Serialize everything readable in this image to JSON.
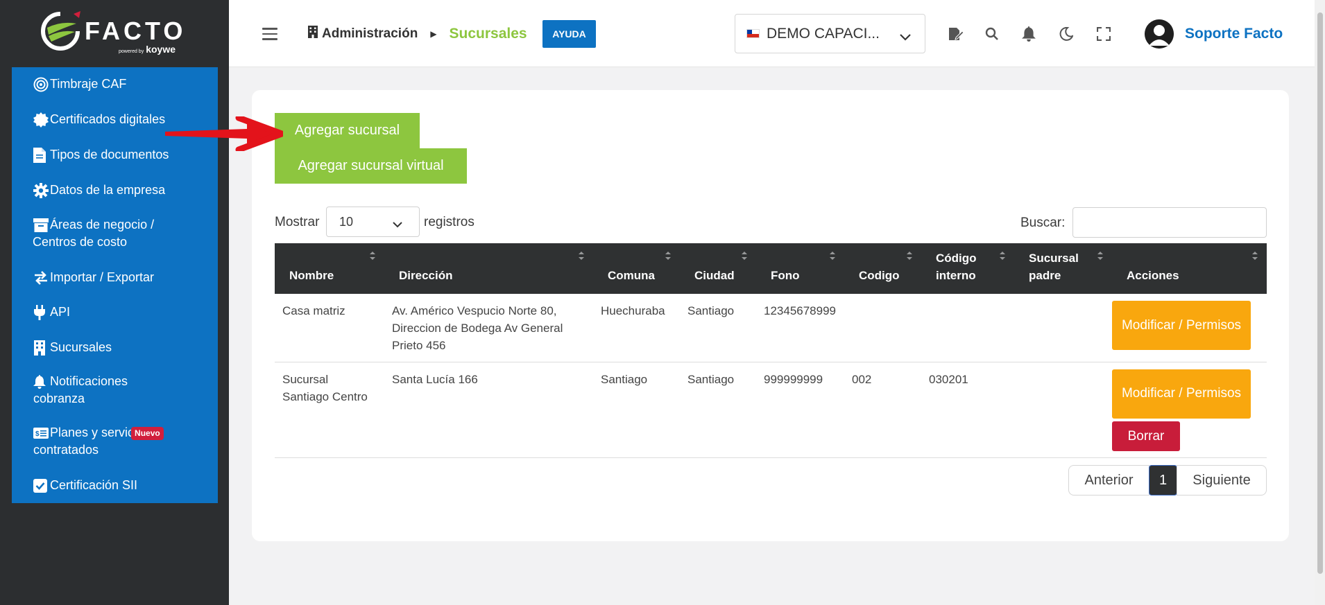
{
  "brand": {
    "name": "FACTO",
    "powered": "powered by",
    "partner": "koywe"
  },
  "sidebar": {
    "items": [
      {
        "label": "Timbraje CAF",
        "icon": "target-icon"
      },
      {
        "label": "Certificados digitales",
        "icon": "certificate-icon"
      },
      {
        "label": "Tipos de documentos",
        "icon": "document-icon"
      },
      {
        "label": "Datos de la empresa",
        "icon": "gear-icon"
      },
      {
        "label": "Áreas de negocio /",
        "label2": "Centros de costo",
        "icon": "archive-icon"
      },
      {
        "label": "Importar / Exportar",
        "icon": "swap-icon"
      },
      {
        "label": "API",
        "icon": "plug-icon"
      },
      {
        "label": "Sucursales",
        "icon": "building-icon"
      },
      {
        "label": "Notificaciones",
        "label2": "cobranza",
        "icon": "bell-icon"
      },
      {
        "label": "Planes y servic",
        "label2": "contratados",
        "badge": "Nuevo",
        "icon": "money-icon"
      },
      {
        "label": "Certificación SII",
        "icon": "check-square-icon"
      }
    ]
  },
  "header": {
    "breadcrumb_root": "Administración",
    "breadcrumb_current": "Sucursales",
    "help_label": "AYUDA",
    "company": "DEMO CAPACI...",
    "user": "Soporte Facto"
  },
  "main": {
    "add_branch": "Agregar sucursal",
    "add_virtual_branch": "Agregar sucursal virtual",
    "show_label": "Mostrar",
    "page_length": "10",
    "records_label": "registros",
    "search_label": "Buscar:",
    "columns": [
      {
        "l1": "Nombre",
        "l2": ""
      },
      {
        "l1": "Dirección",
        "l2": ""
      },
      {
        "l1": "Comuna",
        "l2": ""
      },
      {
        "l1": "Ciudad",
        "l2": ""
      },
      {
        "l1": "Fono",
        "l2": ""
      },
      {
        "l1": "Codigo",
        "l2": ""
      },
      {
        "l1": "Código",
        "l2": "interno"
      },
      {
        "l1": "Sucursal",
        "l2": "padre"
      },
      {
        "l1": "Acciones",
        "l2": ""
      }
    ],
    "rows": [
      {
        "nombre": "Casa matriz",
        "direccion": "Av. Américo Vespucio Norte 80, Direccion de Bodega Av General Prieto 456",
        "comuna": "Huechuraba",
        "ciudad": "Santiago",
        "fono": "12345678999",
        "codigo": "",
        "codigo_interno": "",
        "sucursal_padre": "",
        "modify": "Modificar / Permisos"
      },
      {
        "nombre": "Sucursal Santiago Centro",
        "direccion": "Santa Lucía 166",
        "comuna": "Santiago",
        "ciudad": "Santiago",
        "fono": "999999999",
        "codigo": "002",
        "codigo_interno": "030201",
        "sucursal_padre": "",
        "modify": "Modificar / Permisos",
        "delete": "Borrar"
      }
    ],
    "pagination": {
      "prev": "Anterior",
      "current": "1",
      "next": "Siguiente"
    }
  },
  "colors": {
    "blue": "#0d72c2",
    "green": "#8dc63f",
    "orange": "#f9a70e",
    "red": "#c81d3a",
    "dark": "#2c2e30"
  }
}
